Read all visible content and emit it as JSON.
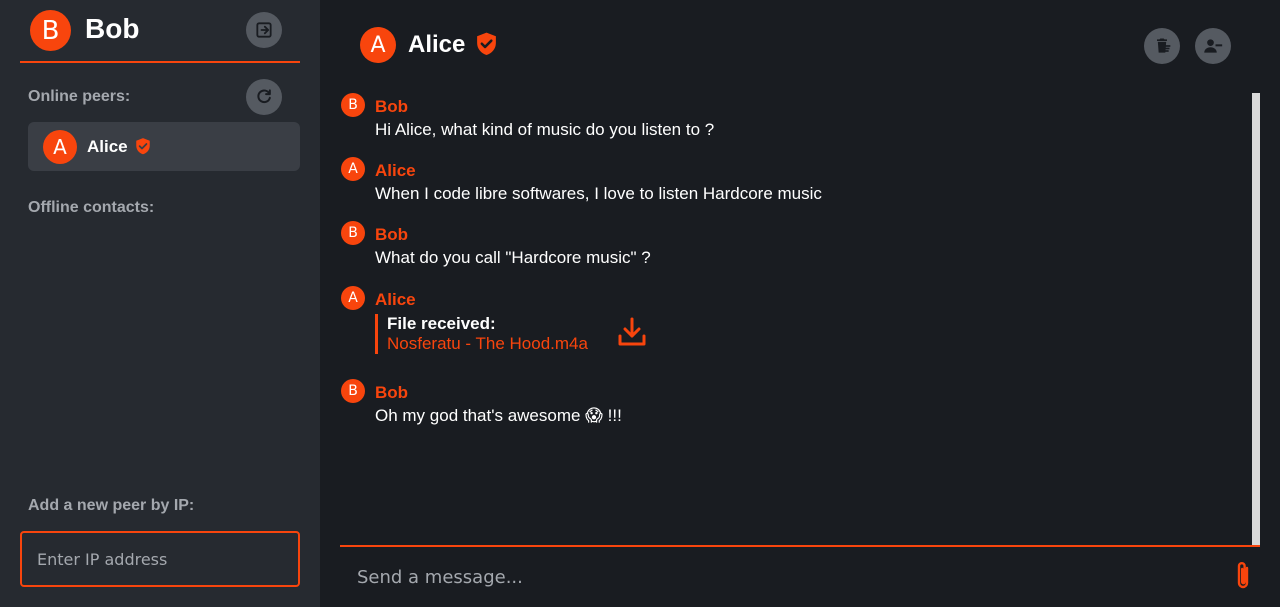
{
  "sidebar": {
    "me": {
      "initial": "B",
      "name": "Bob"
    },
    "online_label": "Online peers:",
    "online_peers": [
      {
        "initial": "A",
        "name": "Alice",
        "verified": true
      }
    ],
    "offline_label": "Offline contacts:",
    "add_peer_label": "Add a new peer by IP:",
    "ip_placeholder": "Enter IP address",
    "icons": {
      "logout": "logout-icon",
      "refresh": "refresh-icon",
      "verified": "verified-shield-icon"
    }
  },
  "chat": {
    "peer": {
      "initial": "A",
      "name": "Alice",
      "verified": true
    },
    "icons": {
      "clear": "delete-history-icon",
      "remove": "remove-user-icon",
      "download": "download-icon",
      "attach": "paperclip-icon"
    },
    "messages": [
      {
        "initial": "B",
        "author": "Bob",
        "text": "Hi Alice, what kind of music do you listen to ?"
      },
      {
        "initial": "A",
        "author": "Alice",
        "text": "When I code libre softwares, I love to listen Hardcore music"
      },
      {
        "initial": "B",
        "author": "Bob",
        "text": "What do you call \"Hardcore music\" ?"
      },
      {
        "initial": "A",
        "author": "Alice",
        "file_title": "File received:",
        "file_name": "Nosferatu - The Hood.m4a"
      },
      {
        "initial": "B",
        "author": "Bob",
        "text": "Oh my god that's awesome 😱 !!!"
      }
    ],
    "input_placeholder": "Send a message..."
  },
  "colors": {
    "accent": "#f8450d",
    "sidebar_bg": "#262a30",
    "main_bg": "#191c21",
    "selected_bg": "#3a3e45",
    "muted_text": "#a4a8ae",
    "button_bg": "#555a61"
  }
}
